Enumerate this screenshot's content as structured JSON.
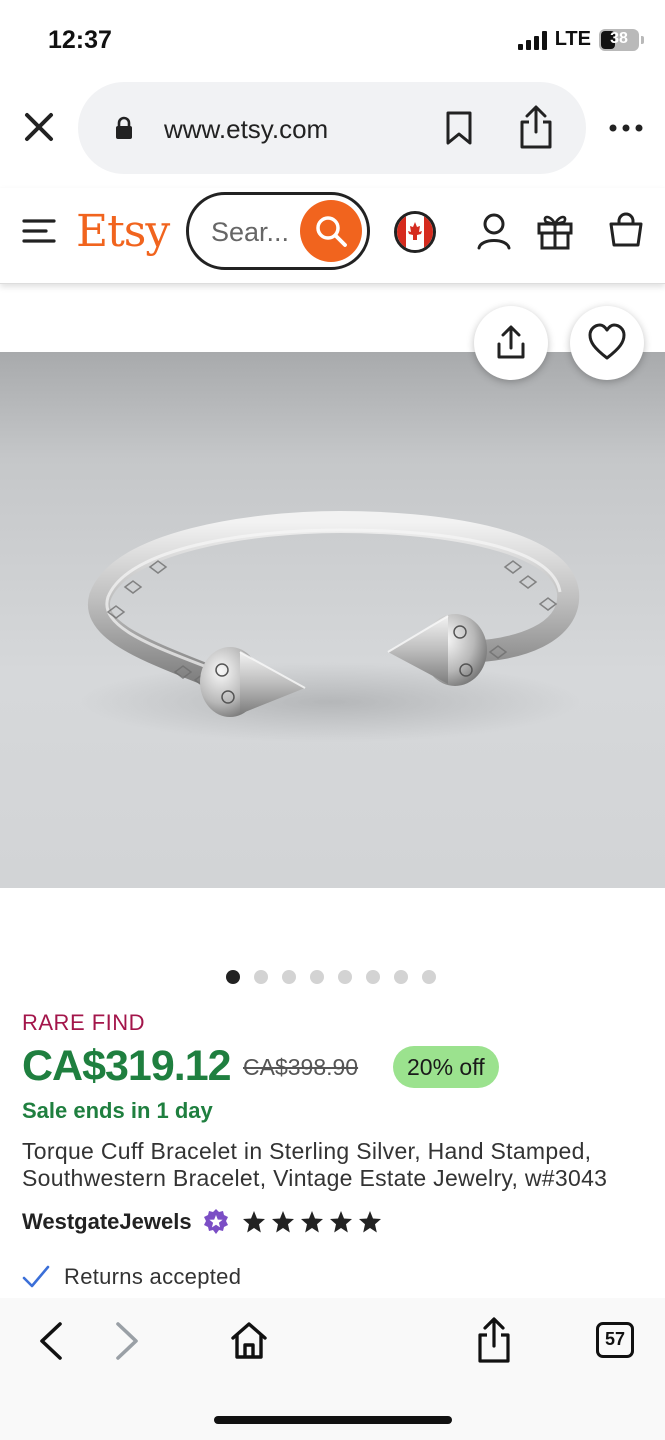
{
  "status_bar": {
    "time": "12:37",
    "network": "LTE",
    "battery": "38",
    "battery_level": 0.38
  },
  "browser": {
    "url": "www.etsy.com",
    "tabs_count": "57",
    "icons": {
      "close": "close-icon",
      "lock": "lock-icon",
      "bookmark": "bookmark-icon",
      "share": "share-icon",
      "more": "more-icon",
      "back": "chevron-left-icon",
      "forward": "chevron-right-icon",
      "home": "home-icon",
      "tabs": "tabs-icon"
    }
  },
  "etsy_header": {
    "logo": "Etsy",
    "search_placeholder": "Sear...",
    "icons": {
      "menu": "hamburger-icon",
      "search": "search-icon",
      "region": "canada-flag-icon",
      "account": "user-icon",
      "gift": "gift-icon",
      "cart": "shopping-bag-icon"
    }
  },
  "product": {
    "image_count": 8,
    "active_image_index": 0,
    "badge": "RARE FIND",
    "price": "CA$319.12",
    "original_price": "CA$398.90",
    "discount": "20% off",
    "sale_notice": "Sale ends in 1 day",
    "title": "Torque Cuff Bracelet in Sterling Silver, Hand Stamped, Southwestern Bracelet, Vintage Estate Jewelry, w#3043",
    "seller": "WestgateJewels",
    "rating": 5,
    "returns": "Returns accepted"
  },
  "colors": {
    "etsy_orange": "#f1641e",
    "price_green": "#1f7f3f",
    "rare_find": "#a3154a",
    "discount_bg": "#9be28e",
    "star_seller_purple": "#7b4ec5"
  }
}
